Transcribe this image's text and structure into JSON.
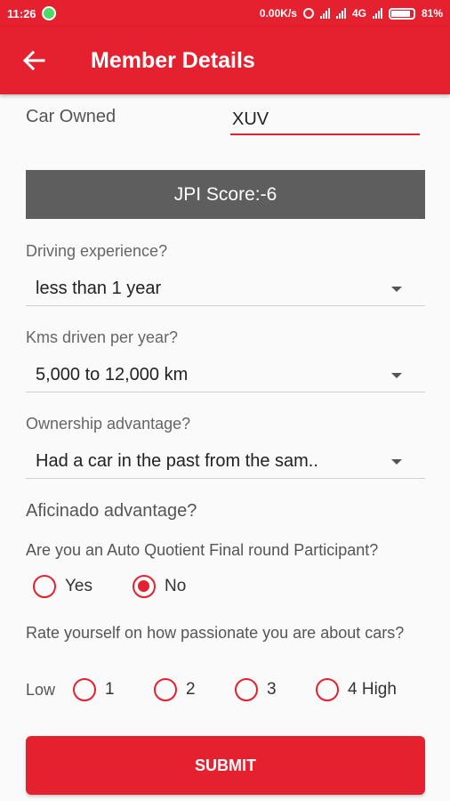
{
  "status_bar": {
    "time": "11:26",
    "speed": "0.00K/s",
    "network": "4G",
    "battery": "81%"
  },
  "app_bar": {
    "title": "Member Details",
    "back_icon": "arrow-left-icon"
  },
  "form": {
    "car_owned_label": "Car Owned",
    "car_owned_value": "XUV",
    "jpi_score": "JPI Score:-6",
    "driving_experience": {
      "label": "Driving experience?",
      "value": "less than 1 year"
    },
    "kms_driven": {
      "label": "Kms driven per year?",
      "value": "5,000 to 12,000 km"
    },
    "ownership_advantage": {
      "label": "Ownership advantage?",
      "value": "Had a car in the past from the sam.."
    },
    "aficinado_title": "Aficinado advantage?",
    "auto_quotient": {
      "question": "Are you an Auto Quotient Final round Participant?",
      "options": [
        "Yes",
        "No"
      ],
      "selected": "No"
    },
    "passion": {
      "question": "Rate yourself on how passionate you are about cars?",
      "low_label": "Low",
      "options": [
        "1",
        "2",
        "3",
        "4 High"
      ]
    },
    "submit_label": "SUBMIT"
  },
  "colors": {
    "primary": "#e5202f",
    "jpi_bg": "#5e5e5e"
  }
}
